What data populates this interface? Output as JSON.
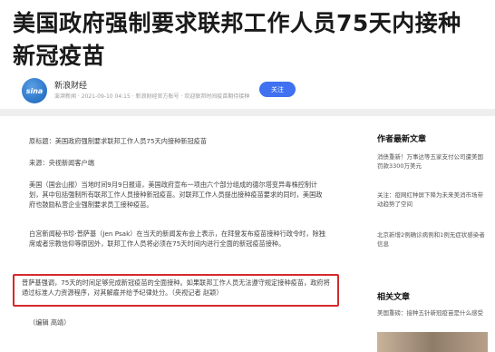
{
  "article": {
    "title": "美国政府强制要求联邦工作人员75天内接种新冠疫苗",
    "author": {
      "avatar_text": "sina",
      "name": "新浪财经",
      "meta": "澎湃新闻 · 2021-09-10 04:15  · 新浪财经官方账号 · 欢迎联邦时间疫苗期待接种",
      "follow_label": "关注"
    },
    "paragraphs": [
      "原标题：美国政府强制要求联邦工作人员75天内接种新冠疫苗",
      "来源：央视新闻客户端",
      "美国（国会山报）当地时间9月9日报道，美国政府宣布一项由六个部分组成的德尔塔变异毒株控制计划，其中包括强制所有联邦工作人员接种新冠疫苗。对联邦工作人员提出接种疫苗要求的同时，美国政府也鼓励私营企业强制要求员工接种疫苗。",
      "白宫新闻秘书珍·普萨基（Jen Psak）在当天的新闻发布会上表示，在拜登发布疫苗接种行政令时，除独席或者宗教信仰等原因外，联邦工作人员将必须在75天时间内进行全面的新冠疫苗接种。",
      "普萨基强调，75天的时间足够完成新冠疫苗的全面接种。如果联邦工作人员无法遵守规定接种疫苗，政府将通过标准人力资源程序，对其解雇并给予纪律处分。（央视记者 赵颖）",
      "（编辑 高靖）"
    ]
  },
  "sidebar": {
    "latest_heading": "作者最新文章",
    "latest_items": [
      "消债重新！万事达等五家支付公司遭美国罚款3300万美元",
      "关注：疫网红种屏下降为未来美消市场带动趋势了空间",
      "北京新增2例确诊病例和1例无症状感染者信息"
    ],
    "related_heading": "相关文章",
    "related_items": [
      "美国重磅：接种五针新冠疫苗是什么感受"
    ]
  }
}
